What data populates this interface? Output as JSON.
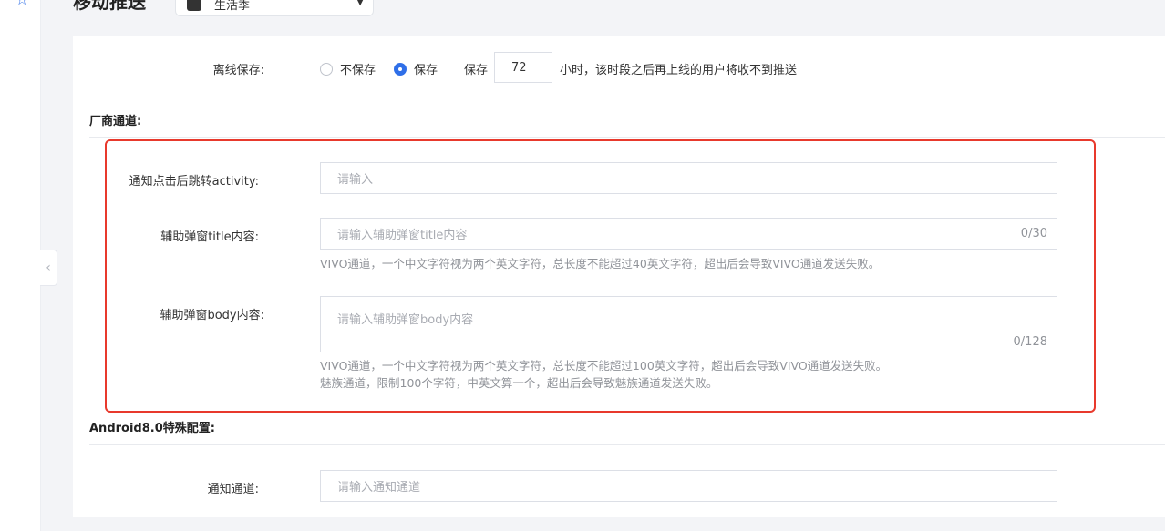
{
  "header": {
    "page_title": "移动推送",
    "app_selector": {
      "value": "生活季",
      "icon": "app-avatar-icon"
    }
  },
  "offline_save": {
    "label": "离线保存:",
    "options": [
      {
        "label": "不保存",
        "checked": false
      },
      {
        "label": "保存",
        "checked": true
      }
    ],
    "save_prefix": "保存",
    "hours_value": "72",
    "hours_suffix": "小时，该时段之后再上线的用户将收不到推送"
  },
  "vendor_channel": {
    "title": "厂商通道:",
    "activity": {
      "label": "通知点击后跳转activity:",
      "placeholder": "请输入"
    },
    "popup_title": {
      "label": "辅助弹窗title内容:",
      "placeholder": "请输入辅助弹窗title内容",
      "counter": "0/30",
      "hint": "VIVO通道，一个中文字符视为两个英文字符，总长度不能超过40英文字符，超出后会导致VIVO通道发送失败。"
    },
    "popup_body": {
      "label": "辅助弹窗body内容:",
      "placeholder": "请输入辅助弹窗body内容",
      "counter": "0/128",
      "hint_vivo": "VIVO通道，一个中文字符视为两个英文字符，总长度不能超过100英文字符，超出后会导致VIVO通道发送失败。",
      "hint_meizu": "魅族通道，限制100个字符，中英文算一个，超出后会导致魅族通道发送失败。"
    }
  },
  "android8": {
    "title": "Android8.0特殊配置:",
    "channel": {
      "label": "通知通道:",
      "placeholder": "请输入通知通道"
    }
  },
  "colors": {
    "accent": "#2f6fe8",
    "highlight": "#e8392c"
  }
}
